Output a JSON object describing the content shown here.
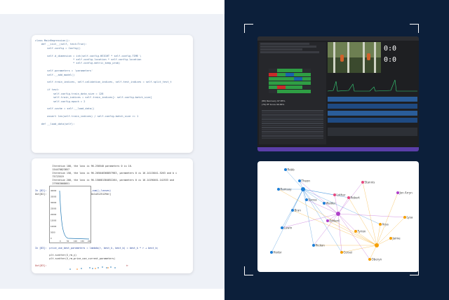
{
  "code_panel": {
    "lines": [
      "class MainRegression():",
      "    def __init__(self, test=True):",
      "        self.config = Config()",
      "",
      "        self.d_dimension = int(self.config.HEIGHT * self.config.TIME \\",
      "                         * self.config.location * self.config.location",
      "                         * self.config.metric_keep_prob)",
      "",
      "        self.parameters = 'parameters'",
      "        self.__add_model()",
      "",
      "        self.train_indices, self.validation_indices, self.test_indices = self.split_test_t",
      "",
      "        if test:",
      "            self.config.train_data_size = 128",
      "            self.train_indices = self.train_indices[: self.config.batch_size]",
      "            self.config.epoch = 2",
      "",
      "        self.cache = self.__load_data()",
      "",
      "        assert len(self.train_indices) / self.config.batch_size >= 1",
      "",
      "    def __load_data(self):"
    ]
  },
  "notebook_panel": {
    "lines_top": [
      "            Iteration 100, the loss is 96.250540 parameters 0 is 16.",
      "            154478823857",
      "            Iteration 150, the loss is 96.205046368857983, parameters 0 is 16.14115041.5263 and b i",
      "            75723519",
      "            Iteration 200, the loss is 96.150681384852264, parameters 0 is 16.14190461.142533 and",
      "            279563668051"
    ],
    "cell_82_in": "In [82]:  plt.plot(list(range(iteration_num)),losses)",
    "cell_82_out": "Out[82]:  [<matplotlib.lines.Line2D at 0x1a5125129d>]",
    "y_ticks": [
      "40000",
      "35000",
      "30000",
      "25000",
      "20000",
      "15000",
      "10000",
      "5000",
      "0"
    ],
    "x_ticks": [
      "0",
      "50",
      "100",
      "150",
      "200"
    ],
    "cell_83_in": "In [83]:  price_use_best_parameters = lambda(r, best_k, best_b) = best_k * r + best_b;",
    "cell_83_body": [
      "          plt.scatter(X_rm,y)",
      "          plt.scatter(X_rm,price_use_current_parameters)"
    ],
    "cell_83_out": "Out[83]:  <matplotlib.collections.PathCollection at 0x1a5e7ce820>"
  },
  "editor": {
    "timecodes": [
      "0:0",
      "0:0"
    ],
    "stats_title": "Stats",
    "stats": [
      "(80) Recovery 97.85%",
      "(79) PF Score 99.84%"
    ],
    "grid_colors": [
      "#2f9e44",
      "#c92a2a",
      "#1864ab",
      "#2b2d31"
    ]
  },
  "network": {
    "nodes": [
      {
        "label": "Robb",
        "color": "#1c7ed6"
      },
      {
        "label": "Ramsay",
        "color": "#1c7ed6"
      },
      {
        "label": "Theon",
        "color": "#1c7ed6"
      },
      {
        "label": "Sansa",
        "color": "#1c7ed6"
      },
      {
        "label": "Bran",
        "color": "#1c7ed6"
      },
      {
        "label": "Walder",
        "color": "#1c7ed6"
      },
      {
        "label": "Lothar",
        "color": "#e64980"
      },
      {
        "label": "Robert",
        "color": "#e64980"
      },
      {
        "label": "Stannis",
        "color": "#e64980"
      },
      {
        "label": "Jon Arryn",
        "color": "#ae3ec9"
      },
      {
        "label": "Arya",
        "color": "#f59f00"
      },
      {
        "label": "Tyrion",
        "color": "#f59f00"
      },
      {
        "label": "Jaime",
        "color": "#f59f00"
      },
      {
        "label": "Cersei",
        "color": "#f59f00"
      },
      {
        "label": "Lysa",
        "color": "#f59f00"
      },
      {
        "label": "Oberyn",
        "color": "#f59f00"
      },
      {
        "label": "Eddard",
        "color": "#ae3ec9"
      },
      {
        "label": "Luwin",
        "color": "#1c7ed6"
      },
      {
        "label": "Hodor",
        "color": "#1c7ed6"
      },
      {
        "label": "Rickon",
        "color": "#1c7ed6"
      }
    ]
  }
}
